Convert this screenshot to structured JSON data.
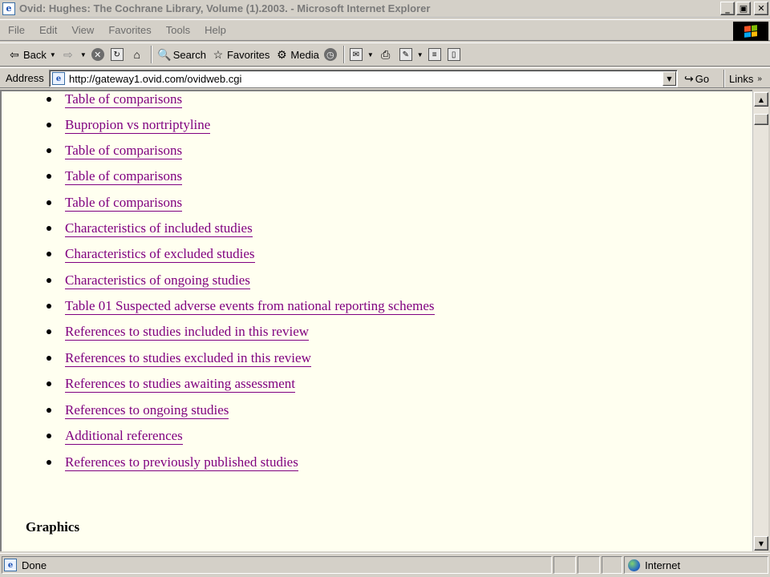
{
  "window": {
    "title": "Ovid: Hughes: The Cochrane Library, Volume (1).2003. - Microsoft Internet Explorer",
    "app_icon_glyph": "e",
    "minimize_glyph": "_",
    "maximize_glyph": "▣",
    "close_glyph": "✕"
  },
  "menubar": {
    "items": [
      "File",
      "Edit",
      "View",
      "Favorites",
      "Tools",
      "Help"
    ]
  },
  "toolbar": {
    "back_label": "Back",
    "search_label": "Search",
    "favorites_label": "Favorites",
    "media_label": "Media"
  },
  "addressbar": {
    "label": "Address",
    "url": "http://gateway1.ovid.com/ovidweb.cgi",
    "go_label": "Go",
    "links_label": "Links"
  },
  "content": {
    "links": [
      "Table of comparisons",
      "Bupropion vs nortriptyline",
      "Table of comparisons",
      "Table of comparisons",
      "Table of comparisons",
      "Characteristics of included studies",
      "Characteristics of excluded studies",
      "Characteristics of ongoing studies",
      "Table 01 Suspected adverse events from national reporting schemes",
      "References to studies included in this review",
      "References to studies excluded in this review",
      "References to studies awaiting assessment",
      "References to ongoing studies",
      "Additional references",
      "References to previously published studies"
    ],
    "graphics_heading": "Graphics"
  },
  "statusbar": {
    "status": "Done",
    "zone": "Internet"
  },
  "colors": {
    "link_visited": "#800080",
    "page_background": "#fffff0",
    "chrome": "#d4d0c8"
  }
}
